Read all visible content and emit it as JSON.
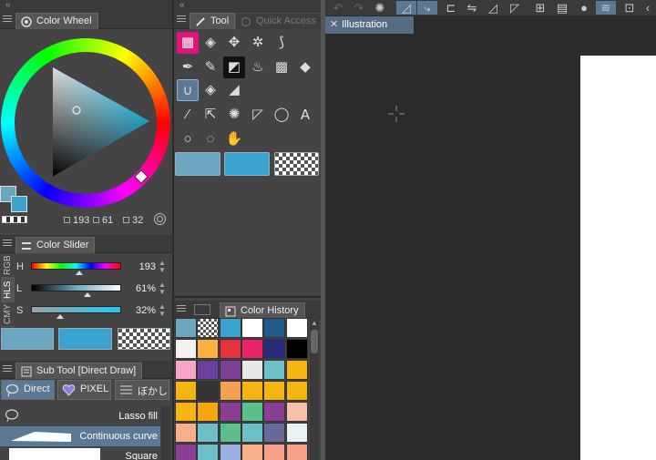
{
  "colors": {
    "main": "#6ca7c1",
    "sub": "#3aa3cf",
    "accent": "#5b7894"
  },
  "color_wheel": {
    "tab_label": "Color Wheel",
    "h": "193",
    "s": "61",
    "v": "32"
  },
  "color_slider": {
    "tab_label": "Color Slider",
    "modes": [
      "RGB",
      "HLS",
      "CMY"
    ],
    "rows": [
      {
        "label": "H",
        "value": "193"
      },
      {
        "label": "L",
        "value": "61%"
      },
      {
        "label": "S",
        "value": "32%"
      }
    ]
  },
  "sub_tool": {
    "tab_label": "Sub Tool [Direct Draw]",
    "buttons": [
      "Direct",
      "PIXEL",
      "ぼかし"
    ],
    "items": [
      "Lasso fill",
      "Continuous curve",
      "Square"
    ]
  },
  "tool_palette": {
    "tab_tool": "Tool",
    "tab_quick": "Quick Access",
    "icons": [
      "direct-draw-icon",
      "layer-move-icon",
      "move-icon",
      "magic-wand-icon",
      "operation-icon",
      "pen-icon",
      "pencil-icon",
      "brush-icon",
      "airbrush-icon",
      "decoration-icon",
      "eraser-icon",
      "lasso-icon",
      "fill-icon",
      "gradient-icon",
      "eyedropper-icon",
      "select-icon",
      "burst-icon",
      "ruler-icon",
      "balloon-icon",
      "text-icon",
      "zoom-icon",
      "rotate-icon",
      "hand-icon"
    ]
  },
  "color_history": {
    "tab_label": "Color History",
    "swatches": [
      "#6ca7c1",
      "checker",
      "#3aa3cf",
      "#ffffff",
      "#1e5a8c",
      "#ffffff",
      "#f2f2f2",
      "#fbb040",
      "#e6323c",
      "#e8236a",
      "#2a2a7c",
      "#000000",
      "#f7a6c9",
      "#6a3fa0",
      "#7b3f94",
      "#e8e8e8",
      "#6cc0c8",
      "#f5b40f",
      "#f5b40f",
      "#333333",
      "#f5a050",
      "#f5b40f",
      "#f5b40f",
      "#f5b40f",
      "#f5b40f",
      "#f5a50f",
      "#8a3f94",
      "#5cc08a",
      "#8a3f94",
      "#f7c0a8",
      "#f7b08a",
      "#6cc0c8",
      "#5cc08a",
      "#6cc0c8",
      "#6a6a9a",
      "#e8f4f4",
      "#8a3f94",
      "#6cc0c8",
      "#9ab0e0",
      "#f7b08a",
      "#f7a08a",
      "#f7a08a"
    ]
  },
  "canvas": {
    "doc_tab": "Illustration"
  }
}
